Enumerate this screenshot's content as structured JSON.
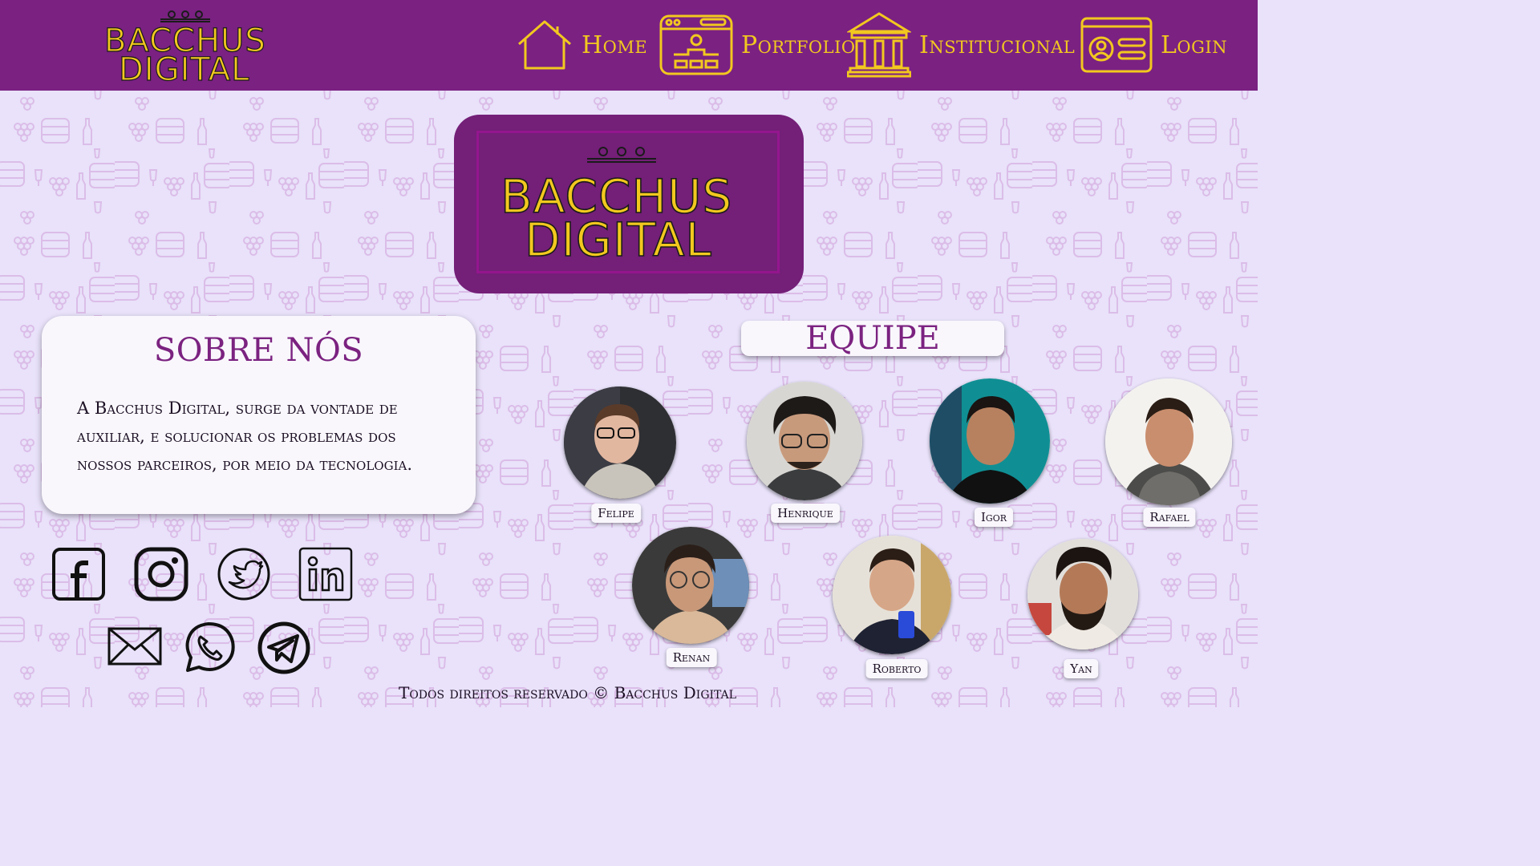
{
  "brand": {
    "name_line1": "BACCHUS",
    "name_line2": "DIGITAL"
  },
  "nav": {
    "home": "Home",
    "portfolio": "Portfolio",
    "institucional": "Institucional",
    "login": "Login"
  },
  "about": {
    "title": "SOBRE NÓS",
    "text": "A Bacchus Digital, surge da vontade de auxiliar, e solucionar os problemas dos nossos parceiros, por meio da tecnologia."
  },
  "team": {
    "title": "EQUIPE",
    "members": [
      {
        "name": "Felipe"
      },
      {
        "name": "Henrique"
      },
      {
        "name": "Igor"
      },
      {
        "name": "Rafael"
      },
      {
        "name": "Renan"
      },
      {
        "name": "Roberto"
      },
      {
        "name": "Yan"
      }
    ]
  },
  "social": [
    "facebook-icon",
    "instagram-icon",
    "twitter-icon",
    "linkedin-icon",
    "email-icon",
    "whatsapp-icon",
    "telegram-icon"
  ],
  "footer": {
    "text": "Todos direitos reservado © Bacchus Digital"
  },
  "colors": {
    "navbar": "#7a2182",
    "accent_gold": "#f2c81f",
    "title_purple": "#7b2280",
    "background": "#e9e2fa",
    "pattern": "#d7b8e6"
  }
}
